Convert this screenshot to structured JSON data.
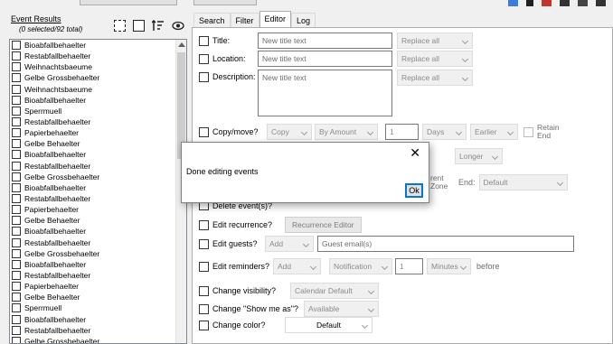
{
  "left": {
    "title": "Event Results",
    "subtitle": "(0 selected/92 total)",
    "events": [
      "Bioabfallbehaelter",
      "Restabfallbehaelter",
      "Weihnachtsbaeume",
      "Gelbe Grossbehaelter",
      "Weihnachtsbaeume",
      "Bioabfallbehaelter",
      "Sperrmuell",
      "Restabfallbehaelter",
      "Papierbehaelter",
      "Gelbe Behaelter",
      "Bioabfallbehaelter",
      "Restabfallbehaelter",
      "Gelbe Grossbehaelter",
      "Bioabfallbehaelter",
      "Restabfallbehaelter",
      "Papierbehaelter",
      "Gelbe Behaelter",
      "Bioabfallbehaelter",
      "Restabfallbehaelter",
      "Gelbe Grossbehaelter",
      "Bioabfallbehaelter",
      "Restabfallbehaelter",
      "Papierbehaelter",
      "Gelbe Behaelter",
      "Sperrmuell",
      "Bioabfallbehaelter",
      "Restabfallbehaelter",
      "Gelbe Grossbehaelter"
    ]
  },
  "tabs": [
    "Search",
    "Filter",
    "Editor",
    "Log"
  ],
  "editor": {
    "title_label": "Title:",
    "title_placeholder": "New title text",
    "title_mode": "Replace all",
    "location_label": "Location:",
    "location_placeholder": "New title text",
    "location_mode": "Replace all",
    "description_label": "Description:",
    "description_placeholder": "New title text",
    "description_mode": "Replace all",
    "copymove_label": "Copy/move?",
    "copymove_mode": "Copy",
    "copymove_by": "By Amount",
    "copymove_amount": "1",
    "copymove_unit": "Days",
    "copymove_dir": "Earlier",
    "retain_end": "Retain End",
    "longer": "Longer",
    "time_zone_partial": "rent Zone",
    "end_label": "End:",
    "end_value": "Default",
    "delete_label": "Delete event(s)?",
    "recurrence_label": "Edit recurrence?",
    "recurrence_button": "Recurrence Editor",
    "guests_label": "Edit guests?",
    "guests_mode": "Add",
    "guests_placeholder": "Guest email(s)",
    "reminders_label": "Edit reminders?",
    "reminders_mode": "Add",
    "reminders_type": "Notification",
    "reminders_amount": "1",
    "reminders_unit": "Minutes",
    "reminders_before": "before",
    "visibility_label": "Change visibility?",
    "visibility_value": "Calendar Default",
    "showme_label": "Change \"Show me as\"?",
    "showme_value": "Available",
    "color_label": "Change color?",
    "color_value": "Default"
  },
  "dialog": {
    "message": "Done editing events",
    "ok_label": "Ok",
    "close_glyph": "✕"
  },
  "colors": {
    "accent": "#0078d7",
    "panel": "#f0f0f0"
  }
}
